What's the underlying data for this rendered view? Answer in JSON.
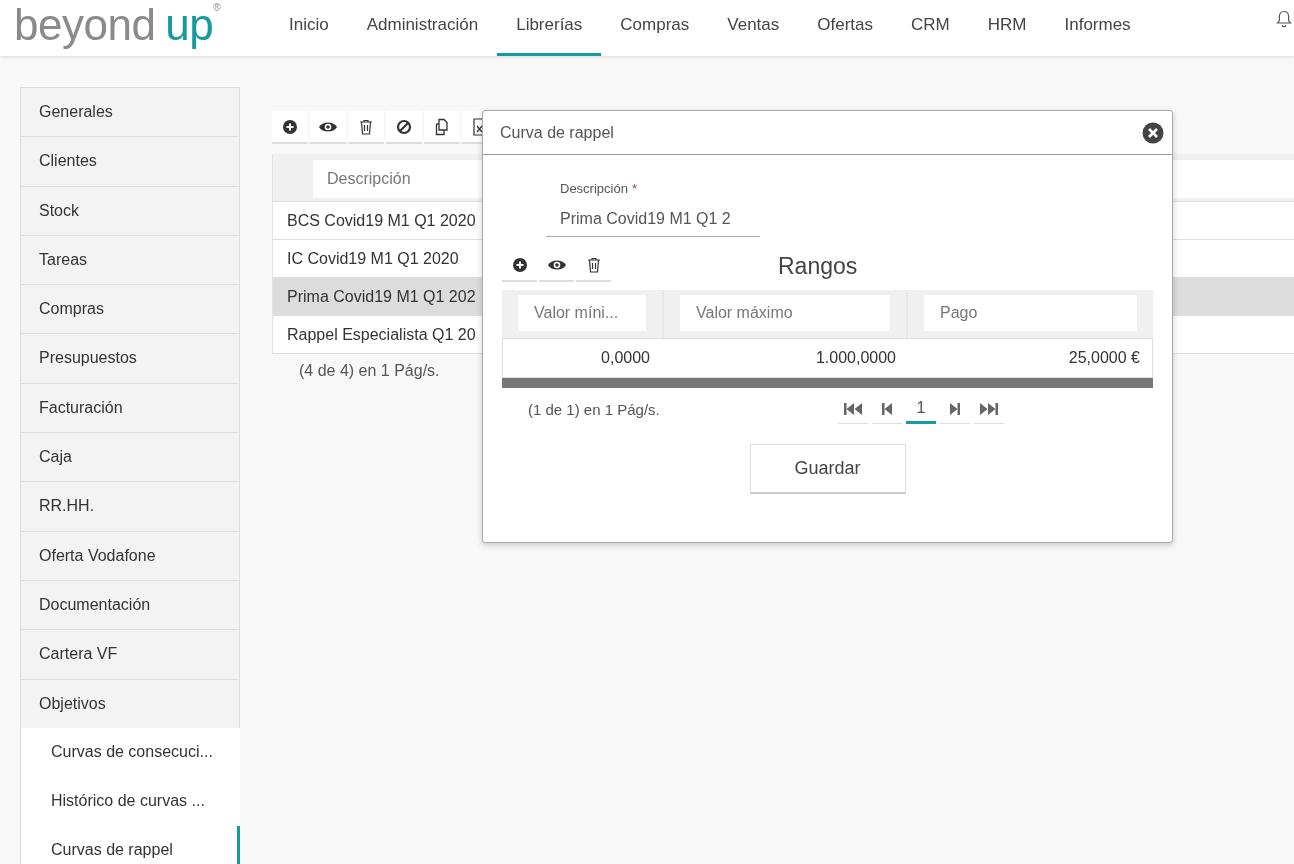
{
  "logo": {
    "word": "beyond",
    "accent": "up",
    "mark": "®"
  },
  "nav": [
    {
      "label": "Inicio",
      "selected": false
    },
    {
      "label": "Administración",
      "selected": false
    },
    {
      "label": "Librerías",
      "selected": true
    },
    {
      "label": "Compras",
      "selected": false
    },
    {
      "label": "Ventas",
      "selected": false
    },
    {
      "label": "Ofertas",
      "selected": false
    },
    {
      "label": "CRM",
      "selected": false
    },
    {
      "label": "HRM",
      "selected": false
    },
    {
      "label": "Informes",
      "selected": false
    }
  ],
  "sidebar": {
    "items": [
      {
        "label": "Generales",
        "expanded": false
      },
      {
        "label": "Clientes",
        "expanded": false
      },
      {
        "label": "Stock",
        "expanded": false
      },
      {
        "label": "Tareas",
        "expanded": false
      },
      {
        "label": "Compras",
        "expanded": false
      },
      {
        "label": "Presupuestos",
        "expanded": false
      },
      {
        "label": "Facturación",
        "expanded": false
      },
      {
        "label": "Caja",
        "expanded": false
      },
      {
        "label": "RR.HH.",
        "expanded": false
      },
      {
        "label": "Oferta Vodafone",
        "expanded": false
      },
      {
        "label": "Documentación",
        "expanded": false
      },
      {
        "label": "Cartera VF",
        "expanded": false
      },
      {
        "label": "Objetivos",
        "expanded": true,
        "children": [
          {
            "label": "Curvas de consecuci...",
            "selected": false
          },
          {
            "label": "Histórico de curvas ...",
            "selected": false
          },
          {
            "label": "Curvas de rappel",
            "selected": true
          }
        ]
      }
    ]
  },
  "list": {
    "toolbar": [
      {
        "kind": "add"
      },
      {
        "kind": "view"
      },
      {
        "kind": "delete"
      },
      {
        "kind": "disable"
      },
      {
        "kind": "copy"
      },
      {
        "kind": "excel"
      }
    ],
    "filter_placeholder": "Descripción",
    "rows": [
      {
        "text": "BCS Covid19 M1 Q1 2020",
        "selected": false
      },
      {
        "text": "IC Covid19 M1 Q1 2020",
        "selected": false
      },
      {
        "text": "Prima Covid19 M1 Q1 202",
        "selected": true
      },
      {
        "text": "Rappel Especialista Q1 20",
        "selected": false
      }
    ],
    "pager": "(4 de 4) en 1 Pág/s."
  },
  "dialog": {
    "title": "Curva de rappel",
    "field": {
      "label": "Descripción",
      "required_mark": "*",
      "value": "Prima Covid19 M1 Q1 2"
    },
    "grid_title": "Rangos",
    "toolbar": [
      {
        "kind": "add"
      },
      {
        "kind": "view"
      },
      {
        "kind": "delete"
      }
    ],
    "columns": [
      {
        "placeholder": "Valor míni..."
      },
      {
        "placeholder": "Valor máximo"
      },
      {
        "placeholder": "Pago"
      }
    ],
    "rows": [
      [
        "0,0000",
        "1.000,0000",
        "25,0000 €"
      ]
    ],
    "pager": {
      "summary": "(1 de 1) en 1 Pág/s.",
      "pages": [
        {
          "label": "1",
          "selected": true
        }
      ]
    },
    "save": "Guardar"
  }
}
